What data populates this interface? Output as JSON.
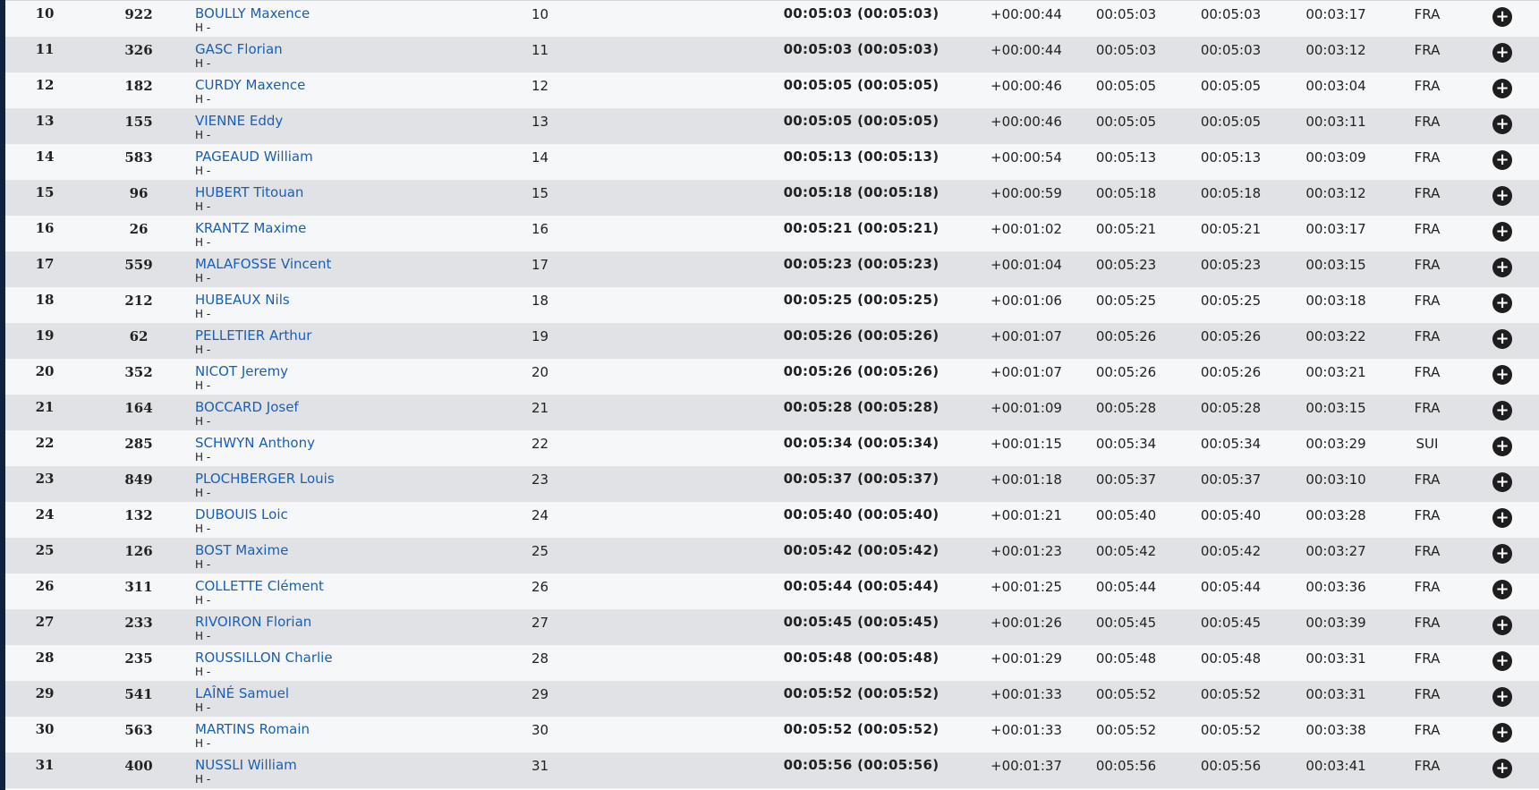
{
  "results": [
    {
      "rank": "10",
      "bib": "922",
      "name": "BOULLY Maxence",
      "category": "H -",
      "cat_rank": "10",
      "time": "00:05:03 (00:05:03)",
      "gap": "+00:00:44",
      "split1": "00:05:03",
      "split2": "00:05:03",
      "split3": "00:03:17",
      "country": "FRA"
    },
    {
      "rank": "11",
      "bib": "326",
      "name": "GASC Florian",
      "category": "H -",
      "cat_rank": "11",
      "time": "00:05:03 (00:05:03)",
      "gap": "+00:00:44",
      "split1": "00:05:03",
      "split2": "00:05:03",
      "split3": "00:03:12",
      "country": "FRA"
    },
    {
      "rank": "12",
      "bib": "182",
      "name": "CURDY Maxence",
      "category": "H -",
      "cat_rank": "12",
      "time": "00:05:05 (00:05:05)",
      "gap": "+00:00:46",
      "split1": "00:05:05",
      "split2": "00:05:05",
      "split3": "00:03:04",
      "country": "FRA"
    },
    {
      "rank": "13",
      "bib": "155",
      "name": "VIENNE Eddy",
      "category": "H -",
      "cat_rank": "13",
      "time": "00:05:05 (00:05:05)",
      "gap": "+00:00:46",
      "split1": "00:05:05",
      "split2": "00:05:05",
      "split3": "00:03:11",
      "country": "FRA"
    },
    {
      "rank": "14",
      "bib": "583",
      "name": "PAGEAUD William",
      "category": "H -",
      "cat_rank": "14",
      "time": "00:05:13 (00:05:13)",
      "gap": "+00:00:54",
      "split1": "00:05:13",
      "split2": "00:05:13",
      "split3": "00:03:09",
      "country": "FRA"
    },
    {
      "rank": "15",
      "bib": "96",
      "name": "HUBERT Titouan",
      "category": "H -",
      "cat_rank": "15",
      "time": "00:05:18 (00:05:18)",
      "gap": "+00:00:59",
      "split1": "00:05:18",
      "split2": "00:05:18",
      "split3": "00:03:12",
      "country": "FRA"
    },
    {
      "rank": "16",
      "bib": "26",
      "name": "KRANTZ Maxime",
      "category": "H -",
      "cat_rank": "16",
      "time": "00:05:21 (00:05:21)",
      "gap": "+00:01:02",
      "split1": "00:05:21",
      "split2": "00:05:21",
      "split3": "00:03:17",
      "country": "FRA"
    },
    {
      "rank": "17",
      "bib": "559",
      "name": "MALAFOSSE Vincent",
      "category": "H -",
      "cat_rank": "17",
      "time": "00:05:23 (00:05:23)",
      "gap": "+00:01:04",
      "split1": "00:05:23",
      "split2": "00:05:23",
      "split3": "00:03:15",
      "country": "FRA"
    },
    {
      "rank": "18",
      "bib": "212",
      "name": "HUBEAUX Nils",
      "category": "H -",
      "cat_rank": "18",
      "time": "00:05:25 (00:05:25)",
      "gap": "+00:01:06",
      "split1": "00:05:25",
      "split2": "00:05:25",
      "split3": "00:03:18",
      "country": "FRA"
    },
    {
      "rank": "19",
      "bib": "62",
      "name": "PELLETIER Arthur",
      "category": "H -",
      "cat_rank": "19",
      "time": "00:05:26 (00:05:26)",
      "gap": "+00:01:07",
      "split1": "00:05:26",
      "split2": "00:05:26",
      "split3": "00:03:22",
      "country": "FRA"
    },
    {
      "rank": "20",
      "bib": "352",
      "name": "NICOT Jeremy",
      "category": "H -",
      "cat_rank": "20",
      "time": "00:05:26 (00:05:26)",
      "gap": "+00:01:07",
      "split1": "00:05:26",
      "split2": "00:05:26",
      "split3": "00:03:21",
      "country": "FRA"
    },
    {
      "rank": "21",
      "bib": "164",
      "name": "BOCCARD Josef",
      "category": "H -",
      "cat_rank": "21",
      "time": "00:05:28 (00:05:28)",
      "gap": "+00:01:09",
      "split1": "00:05:28",
      "split2": "00:05:28",
      "split3": "00:03:15",
      "country": "FRA"
    },
    {
      "rank": "22",
      "bib": "285",
      "name": "SCHWYN Anthony",
      "category": "H -",
      "cat_rank": "22",
      "time": "00:05:34 (00:05:34)",
      "gap": "+00:01:15",
      "split1": "00:05:34",
      "split2": "00:05:34",
      "split3": "00:03:29",
      "country": "SUI"
    },
    {
      "rank": "23",
      "bib": "849",
      "name": "PLOCHBERGER Louis",
      "category": "H -",
      "cat_rank": "23",
      "time": "00:05:37 (00:05:37)",
      "gap": "+00:01:18",
      "split1": "00:05:37",
      "split2": "00:05:37",
      "split3": "00:03:10",
      "country": "FRA"
    },
    {
      "rank": "24",
      "bib": "132",
      "name": "DUBOUIS Loic",
      "category": "H -",
      "cat_rank": "24",
      "time": "00:05:40 (00:05:40)",
      "gap": "+00:01:21",
      "split1": "00:05:40",
      "split2": "00:05:40",
      "split3": "00:03:28",
      "country": "FRA"
    },
    {
      "rank": "25",
      "bib": "126",
      "name": "BOST Maxime",
      "category": "H -",
      "cat_rank": "25",
      "time": "00:05:42 (00:05:42)",
      "gap": "+00:01:23",
      "split1": "00:05:42",
      "split2": "00:05:42",
      "split3": "00:03:27",
      "country": "FRA"
    },
    {
      "rank": "26",
      "bib": "311",
      "name": "COLLETTE Clément",
      "category": "H -",
      "cat_rank": "26",
      "time": "00:05:44 (00:05:44)",
      "gap": "+00:01:25",
      "split1": "00:05:44",
      "split2": "00:05:44",
      "split3": "00:03:36",
      "country": "FRA"
    },
    {
      "rank": "27",
      "bib": "233",
      "name": "RIVOIRON Florian",
      "category": "H -",
      "cat_rank": "27",
      "time": "00:05:45 (00:05:45)",
      "gap": "+00:01:26",
      "split1": "00:05:45",
      "split2": "00:05:45",
      "split3": "00:03:39",
      "country": "FRA"
    },
    {
      "rank": "28",
      "bib": "235",
      "name": "ROUSSILLON Charlie",
      "category": "H -",
      "cat_rank": "28",
      "time": "00:05:48 (00:05:48)",
      "gap": "+00:01:29",
      "split1": "00:05:48",
      "split2": "00:05:48",
      "split3": "00:03:31",
      "country": "FRA"
    },
    {
      "rank": "29",
      "bib": "541",
      "name": "LAÎNÉ Samuel",
      "category": "H -",
      "cat_rank": "29",
      "time": "00:05:52 (00:05:52)",
      "gap": "+00:01:33",
      "split1": "00:05:52",
      "split2": "00:05:52",
      "split3": "00:03:31",
      "country": "FRA"
    },
    {
      "rank": "30",
      "bib": "563",
      "name": "MARTINS Romain",
      "category": "H -",
      "cat_rank": "30",
      "time": "00:05:52 (00:05:52)",
      "gap": "+00:01:33",
      "split1": "00:05:52",
      "split2": "00:05:52",
      "split3": "00:03:38",
      "country": "FRA"
    },
    {
      "rank": "31",
      "bib": "400",
      "name": "NUSSLI William",
      "category": "H -",
      "cat_rank": "31",
      "time": "00:05:56 (00:05:56)",
      "gap": "+00:01:37",
      "split1": "00:05:56",
      "split2": "00:05:56",
      "split3": "00:03:41",
      "country": "FRA"
    }
  ],
  "icons": {
    "expand": "plus-circle-icon",
    "expand_glyph": "+"
  },
  "colors": {
    "link": "#1a5fb4",
    "row_alt": "#e1e2e5",
    "row": "#f6f7f9",
    "frame": "#0f2340"
  }
}
